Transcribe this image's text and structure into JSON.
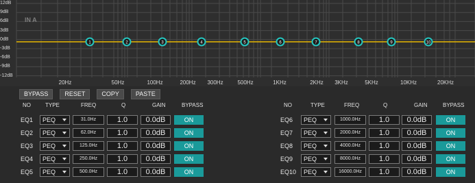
{
  "graph": {
    "channel_label": "IN A",
    "y_labels": [
      "12dB",
      "9dB",
      "6dB",
      "3dB",
      "0dB",
      "-3dB",
      "-6dB",
      "-9dB",
      "-12dB"
    ],
    "x_labels": [
      "20Hz",
      "50Hz",
      "100Hz",
      "200Hz",
      "300Hz",
      "500Hz",
      "1KHz",
      "2KHz",
      "3KHz",
      "5KHz",
      "10KHz",
      "20KHz"
    ],
    "band_markers": [
      "1",
      "2",
      "3",
      "4",
      "5",
      "6",
      "7",
      "8",
      "9",
      "10"
    ],
    "curve_color": "#e8b800",
    "marker_color": "#24c6c0"
  },
  "toolbar": {
    "bypass_label": "BYPASS",
    "reset_label": "RESET",
    "copy_label": "COPY",
    "paste_label": "PASTE"
  },
  "table_headers": [
    "NO",
    "TYPE",
    "FREQ",
    "Q",
    "GAIN",
    "BYPASS"
  ],
  "bands_left": [
    {
      "no": "EQ1",
      "type": "PEQ",
      "freq": "31.0Hz",
      "q": "1.0",
      "gain": "0.0dB",
      "bypass": "ON"
    },
    {
      "no": "EQ2",
      "type": "PEQ",
      "freq": "62.0Hz",
      "q": "1.0",
      "gain": "0.0dB",
      "bypass": "ON"
    },
    {
      "no": "EQ3",
      "type": "PEQ",
      "freq": "125.0Hz",
      "q": "1.0",
      "gain": "0.0dB",
      "bypass": "ON"
    },
    {
      "no": "EQ4",
      "type": "PEQ",
      "freq": "250.0Hz",
      "q": "1.0",
      "gain": "0.0dB",
      "bypass": "ON"
    },
    {
      "no": "EQ5",
      "type": "PEQ",
      "freq": "500.0Hz",
      "q": "1.0",
      "gain": "0.0dB",
      "bypass": "ON"
    }
  ],
  "bands_right": [
    {
      "no": "EQ6",
      "type": "PEQ",
      "freq": "1000.0Hz",
      "q": "1.0",
      "gain": "0.0dB",
      "bypass": "ON"
    },
    {
      "no": "EQ7",
      "type": "PEQ",
      "freq": "2000.0Hz",
      "q": "1.0",
      "gain": "0.0dB",
      "bypass": "ON"
    },
    {
      "no": "EQ8",
      "type": "PEQ",
      "freq": "4000.0Hz",
      "q": "1.0",
      "gain": "0.0dB",
      "bypass": "ON"
    },
    {
      "no": "EQ9",
      "type": "PEQ",
      "freq": "8000.0Hz",
      "q": "1.0",
      "gain": "0.0dB",
      "bypass": "ON"
    },
    {
      "no": "EQ10",
      "type": "PEQ",
      "freq": "16000.0Hz",
      "q": "1.0",
      "gain": "0.0dB",
      "bypass": "ON"
    }
  ]
}
